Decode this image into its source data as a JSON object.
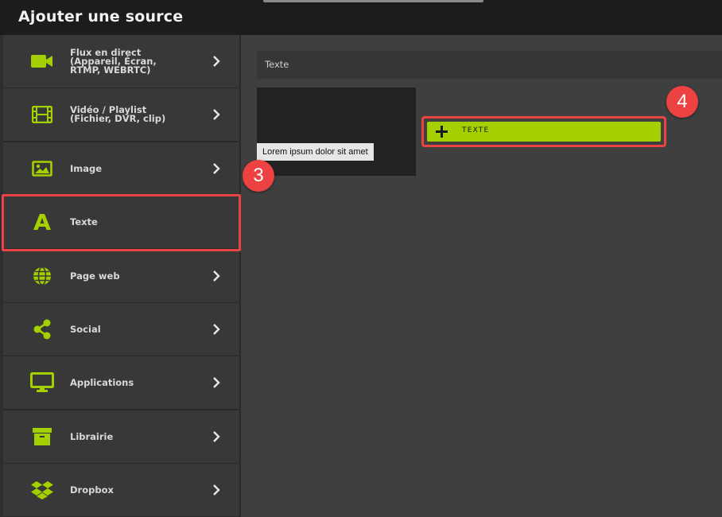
{
  "header": {
    "title": "Ajouter une source"
  },
  "colors": {
    "accent": "#a5d000",
    "annotation": "#e84444"
  },
  "sidebar": {
    "items": [
      {
        "label": "Flux en direct\n(Appareil, Écran,\nRTMP, WEBRTC)",
        "icon": "video-camera-icon",
        "has_chevron": true
      },
      {
        "label": "Vidéo / Playlist\n(Fichier, DVR, clip)",
        "icon": "film-icon",
        "has_chevron": true
      },
      {
        "label": "Image",
        "icon": "image-icon",
        "has_chevron": true
      },
      {
        "label": "Texte",
        "icon": "text-icon",
        "has_chevron": false,
        "selected": true
      },
      {
        "label": "Page web",
        "icon": "globe-icon",
        "has_chevron": true
      },
      {
        "label": "Social",
        "icon": "share-icon",
        "has_chevron": true
      },
      {
        "label": "Applications",
        "icon": "monitor-icon",
        "has_chevron": true
      },
      {
        "label": "Librairie",
        "icon": "archive-box-icon",
        "has_chevron": true
      },
      {
        "label": "Dropbox",
        "icon": "dropbox-icon",
        "has_chevron": true
      }
    ]
  },
  "main": {
    "section_title": "Texte",
    "preview_text": "Lorem ipsum dolor sit amet",
    "add_button_label": "TEXTE"
  },
  "annotations": {
    "step_3": "3",
    "step_4": "4"
  }
}
